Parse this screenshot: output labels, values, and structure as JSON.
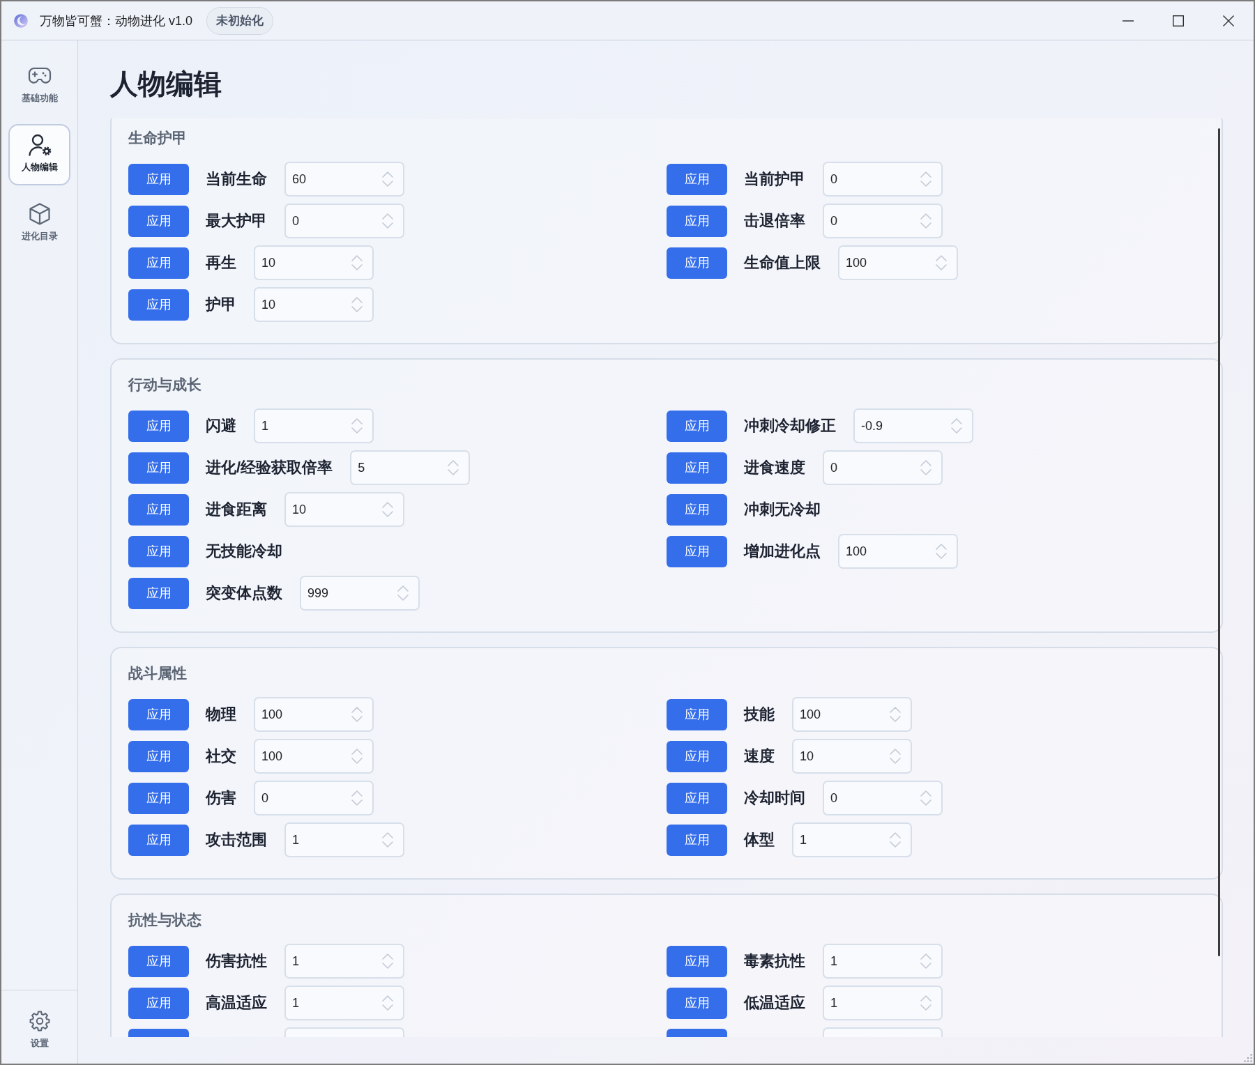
{
  "window": {
    "title": "万物皆可蟹：动物进化 v1.0",
    "status_badge": "未初始化"
  },
  "sidebar": {
    "items": [
      {
        "label": "基础功能",
        "selected": false
      },
      {
        "label": "人物编辑",
        "selected": true
      },
      {
        "label": "进化目录",
        "selected": false
      }
    ],
    "footer": {
      "label": "设置"
    }
  },
  "page_title": "人物编辑",
  "sections": [
    {
      "title": "生命护甲",
      "fields": [
        {
          "kind": "number",
          "button": "应用",
          "label": "当前生命",
          "value": "60"
        },
        {
          "kind": "number",
          "button": "应用",
          "label": "当前护甲",
          "value": "0"
        },
        {
          "kind": "number",
          "button": "应用",
          "label": "最大护甲",
          "value": "0"
        },
        {
          "kind": "number",
          "button": "应用",
          "label": "击退倍率",
          "value": "0"
        },
        {
          "kind": "number",
          "button": "应用",
          "label": "再生",
          "value": "10"
        },
        {
          "kind": "number",
          "button": "应用",
          "label": "生命值上限",
          "value": "100"
        },
        {
          "kind": "number",
          "button": "应用",
          "label": "护甲",
          "value": "10"
        }
      ]
    },
    {
      "title": "行动与成长",
      "fields": [
        {
          "kind": "number",
          "button": "应用",
          "label": "闪避",
          "value": "1"
        },
        {
          "kind": "number",
          "button": "应用",
          "label": "冲刺冷却修正",
          "value": "-0.9"
        },
        {
          "kind": "number",
          "button": "应用",
          "label": "进化/经验获取倍率",
          "value": "5"
        },
        {
          "kind": "number",
          "button": "应用",
          "label": "进食速度",
          "value": "0"
        },
        {
          "kind": "number",
          "button": "应用",
          "label": "进食距离",
          "value": "10"
        },
        {
          "kind": "action",
          "button": "应用",
          "label": "冲刺无冷却"
        },
        {
          "kind": "action",
          "button": "应用",
          "label": "无技能冷却"
        },
        {
          "kind": "number",
          "button": "应用",
          "label": "增加进化点",
          "value": "100"
        },
        {
          "kind": "number",
          "button": "应用",
          "label": "突变体点数",
          "value": "999"
        }
      ]
    },
    {
      "title": "战斗属性",
      "fields": [
        {
          "kind": "number",
          "button": "应用",
          "label": "物理",
          "value": "100"
        },
        {
          "kind": "number",
          "button": "应用",
          "label": "技能",
          "value": "100"
        },
        {
          "kind": "number",
          "button": "应用",
          "label": "社交",
          "value": "100"
        },
        {
          "kind": "number",
          "button": "应用",
          "label": "速度",
          "value": "10"
        },
        {
          "kind": "number",
          "button": "应用",
          "label": "伤害",
          "value": "0"
        },
        {
          "kind": "number",
          "button": "应用",
          "label": "冷却时间",
          "value": "0"
        },
        {
          "kind": "number",
          "button": "应用",
          "label": "攻击范围",
          "value": "1"
        },
        {
          "kind": "number",
          "button": "应用",
          "label": "体型",
          "value": "1"
        }
      ]
    },
    {
      "title": "抗性与状态",
      "fields": [
        {
          "kind": "number",
          "button": "应用",
          "label": "伤害抗性",
          "value": "1"
        },
        {
          "kind": "number",
          "button": "应用",
          "label": "毒素抗性",
          "value": "1"
        },
        {
          "kind": "number",
          "button": "应用",
          "label": "高温适应",
          "value": "1"
        },
        {
          "kind": "number",
          "button": "应用",
          "label": "低温适应",
          "value": "1"
        },
        {
          "kind": "cut_off"
        },
        {
          "kind": "cut_off"
        }
      ]
    }
  ]
}
